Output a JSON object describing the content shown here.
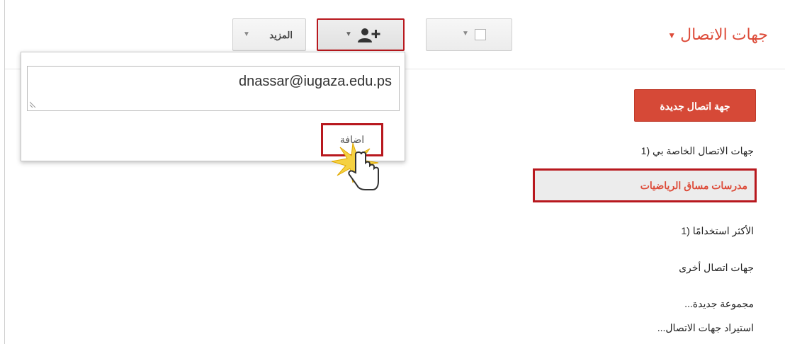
{
  "header": {
    "title": "جهات الاتصال",
    "more_label": "المزيد"
  },
  "popup": {
    "email_value": "dnassar@iugaza.edu.ps",
    "add_label": "اضافة"
  },
  "sidebar": {
    "new_contact_label": "جهة اتصال جديدة",
    "items": [
      {
        "label": "جهات الاتصال الخاصة بي (1"
      },
      {
        "label": "مدرسات مساق الرياضيات"
      },
      {
        "label": "الأكثر استخدامًا (1"
      },
      {
        "label": "جهات اتصال أخرى"
      },
      {
        "label": "مجموعة جديدة..."
      },
      {
        "label": "استيراد جهات الاتصال..."
      }
    ]
  },
  "colors": {
    "accent": "#dd4b39",
    "highlight_border": "#b8181e",
    "button_red": "#d64937"
  },
  "icons": [
    "checkbox-icon",
    "add-person-icon",
    "chevron-down-icon",
    "hand-cursor-icon",
    "resize-grip-icon"
  ]
}
